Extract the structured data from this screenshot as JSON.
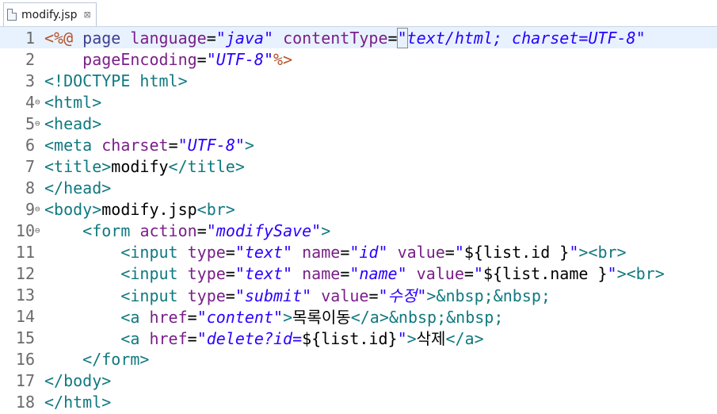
{
  "tab": {
    "label": "modify.jsp",
    "close": "⊠",
    "icon": "file-icon"
  },
  "lines": [
    {
      "n": "1",
      "fold": "",
      "tokens": [
        {
          "c": "t-jsp",
          "t": "<%@"
        },
        {
          "c": "t-txt",
          "t": " "
        },
        {
          "c": "t-kw",
          "t": "page"
        },
        {
          "c": "t-txt",
          "t": " "
        },
        {
          "c": "t-attr",
          "t": "language"
        },
        {
          "c": "t-txt",
          "t": "="
        },
        {
          "c": "t-str",
          "t": "\"java\""
        },
        {
          "c": "t-txt",
          "t": " "
        },
        {
          "c": "t-attr",
          "t": "contentType"
        },
        {
          "c": "t-txt",
          "t": "="
        },
        {
          "c": "t-str bracket-box",
          "t": "\""
        },
        {
          "c": "t-str",
          "t": "text/html; charset=UTF-8\""
        }
      ]
    },
    {
      "n": "2",
      "fold": "",
      "tokens": [
        {
          "c": "t-txt",
          "t": "    "
        },
        {
          "c": "t-attr",
          "t": "pageEncoding"
        },
        {
          "c": "t-txt",
          "t": "="
        },
        {
          "c": "t-str",
          "t": "\"UTF-8\""
        },
        {
          "c": "t-jsp",
          "t": "%>"
        }
      ]
    },
    {
      "n": "3",
      "fold": "",
      "tokens": [
        {
          "c": "t-tag",
          "t": "<!DOCTYPE"
        },
        {
          "c": "t-txt",
          "t": " "
        },
        {
          "c": "t-tag",
          "t": "html>"
        }
      ]
    },
    {
      "n": "4",
      "fold": "⊖",
      "tokens": [
        {
          "c": "t-tag",
          "t": "<html>"
        }
      ]
    },
    {
      "n": "5",
      "fold": "⊖",
      "tokens": [
        {
          "c": "t-tag",
          "t": "<head>"
        }
      ]
    },
    {
      "n": "6",
      "fold": "",
      "tokens": [
        {
          "c": "t-tag",
          "t": "<meta"
        },
        {
          "c": "t-txt",
          "t": " "
        },
        {
          "c": "t-attr",
          "t": "charset"
        },
        {
          "c": "t-txt",
          "t": "="
        },
        {
          "c": "t-str",
          "t": "\"UTF-8\""
        },
        {
          "c": "t-tag",
          "t": ">"
        }
      ]
    },
    {
      "n": "7",
      "fold": "",
      "tokens": [
        {
          "c": "t-tag",
          "t": "<title>"
        },
        {
          "c": "t-txt",
          "t": "modify"
        },
        {
          "c": "t-tag",
          "t": "</title>"
        }
      ]
    },
    {
      "n": "8",
      "fold": "",
      "tokens": [
        {
          "c": "t-tag",
          "t": "</head>"
        }
      ]
    },
    {
      "n": "9",
      "fold": "⊖",
      "tokens": [
        {
          "c": "t-tag",
          "t": "<body>"
        },
        {
          "c": "t-txt",
          "t": "modify.jsp"
        },
        {
          "c": "t-tag",
          "t": "<br>"
        }
      ]
    },
    {
      "n": "10",
      "fold": "⊖",
      "tokens": [
        {
          "c": "t-txt",
          "t": "    "
        },
        {
          "c": "t-tag",
          "t": "<form"
        },
        {
          "c": "t-txt",
          "t": " "
        },
        {
          "c": "t-attr",
          "t": "action"
        },
        {
          "c": "t-txt",
          "t": "="
        },
        {
          "c": "t-str",
          "t": "\"modifySave\""
        },
        {
          "c": "t-tag",
          "t": ">"
        }
      ]
    },
    {
      "n": "11",
      "fold": "",
      "tokens": [
        {
          "c": "t-txt",
          "t": "        "
        },
        {
          "c": "t-tag",
          "t": "<input"
        },
        {
          "c": "t-txt",
          "t": " "
        },
        {
          "c": "t-attr",
          "t": "type"
        },
        {
          "c": "t-txt",
          "t": "="
        },
        {
          "c": "t-str",
          "t": "\"text\""
        },
        {
          "c": "t-txt",
          "t": " "
        },
        {
          "c": "t-attr",
          "t": "name"
        },
        {
          "c": "t-txt",
          "t": "="
        },
        {
          "c": "t-str",
          "t": "\"id\""
        },
        {
          "c": "t-txt",
          "t": " "
        },
        {
          "c": "t-attr",
          "t": "value"
        },
        {
          "c": "t-txt",
          "t": "="
        },
        {
          "c": "t-str",
          "t": "\""
        },
        {
          "c": "t-txt",
          "t": "${list.id }"
        },
        {
          "c": "t-str",
          "t": "\""
        },
        {
          "c": "t-tag",
          "t": "><br>"
        }
      ]
    },
    {
      "n": "12",
      "fold": "",
      "tokens": [
        {
          "c": "t-txt",
          "t": "        "
        },
        {
          "c": "t-tag",
          "t": "<input"
        },
        {
          "c": "t-txt",
          "t": " "
        },
        {
          "c": "t-attr",
          "t": "type"
        },
        {
          "c": "t-txt",
          "t": "="
        },
        {
          "c": "t-str",
          "t": "\"text\""
        },
        {
          "c": "t-txt",
          "t": " "
        },
        {
          "c": "t-attr",
          "t": "name"
        },
        {
          "c": "t-txt",
          "t": "="
        },
        {
          "c": "t-str",
          "t": "\"name\""
        },
        {
          "c": "t-txt",
          "t": " "
        },
        {
          "c": "t-attr",
          "t": "value"
        },
        {
          "c": "t-txt",
          "t": "="
        },
        {
          "c": "t-str",
          "t": "\""
        },
        {
          "c": "t-txt",
          "t": "${list.name }"
        },
        {
          "c": "t-str",
          "t": "\""
        },
        {
          "c": "t-tag",
          "t": "><br>"
        }
      ]
    },
    {
      "n": "13",
      "fold": "",
      "tokens": [
        {
          "c": "t-txt",
          "t": "        "
        },
        {
          "c": "t-tag",
          "t": "<input"
        },
        {
          "c": "t-txt",
          "t": " "
        },
        {
          "c": "t-attr",
          "t": "type"
        },
        {
          "c": "t-txt",
          "t": "="
        },
        {
          "c": "t-str",
          "t": "\"submit\""
        },
        {
          "c": "t-txt",
          "t": " "
        },
        {
          "c": "t-attr",
          "t": "value"
        },
        {
          "c": "t-txt",
          "t": "="
        },
        {
          "c": "t-str",
          "t": "\"수정\""
        },
        {
          "c": "t-tag",
          "t": ">"
        },
        {
          "c": "t-tag",
          "t": "&nbsp;&nbsp;"
        }
      ]
    },
    {
      "n": "14",
      "fold": "",
      "tokens": [
        {
          "c": "t-txt",
          "t": "        "
        },
        {
          "c": "t-tag",
          "t": "<a"
        },
        {
          "c": "t-txt",
          "t": " "
        },
        {
          "c": "t-attr",
          "t": "href"
        },
        {
          "c": "t-txt",
          "t": "="
        },
        {
          "c": "t-str",
          "t": "\"content\""
        },
        {
          "c": "t-tag",
          "t": ">"
        },
        {
          "c": "t-txt",
          "t": "목록이동"
        },
        {
          "c": "t-tag",
          "t": "</a>"
        },
        {
          "c": "t-tag",
          "t": "&nbsp;&nbsp;"
        }
      ]
    },
    {
      "n": "15",
      "fold": "",
      "tokens": [
        {
          "c": "t-txt",
          "t": "        "
        },
        {
          "c": "t-tag",
          "t": "<a"
        },
        {
          "c": "t-txt",
          "t": " "
        },
        {
          "c": "t-attr",
          "t": "href"
        },
        {
          "c": "t-txt",
          "t": "="
        },
        {
          "c": "t-str",
          "t": "\"delete?id="
        },
        {
          "c": "t-txt",
          "t": "${list.id}"
        },
        {
          "c": "t-str",
          "t": "\""
        },
        {
          "c": "t-tag",
          "t": ">"
        },
        {
          "c": "t-txt",
          "t": "삭제"
        },
        {
          "c": "t-tag",
          "t": "</a>"
        }
      ]
    },
    {
      "n": "16",
      "fold": "",
      "tokens": [
        {
          "c": "t-txt",
          "t": "    "
        },
        {
          "c": "t-tag",
          "t": "</form>"
        }
      ]
    },
    {
      "n": "17",
      "fold": "",
      "tokens": [
        {
          "c": "t-tag",
          "t": "</body>"
        }
      ]
    },
    {
      "n": "18",
      "fold": "",
      "tokens": [
        {
          "c": "t-tag",
          "t": "</html>"
        }
      ]
    }
  ]
}
